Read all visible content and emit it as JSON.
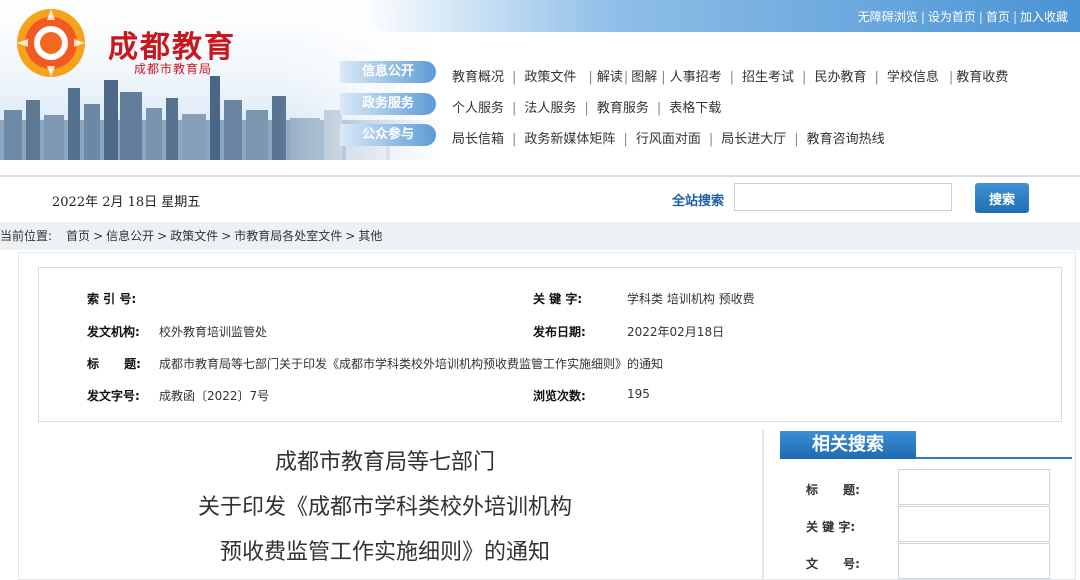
{
  "topbar": {
    "links": [
      "无障碍浏览",
      "设为首页",
      "首页",
      "加入收藏"
    ]
  },
  "logo": {
    "title": "成都教育",
    "subtitle": "成都市教育局"
  },
  "nav": {
    "rows": [
      {
        "category": "信息公开",
        "items": [
          "教育概况",
          "政策文件",
          "解读",
          "图解",
          "人事招考",
          "招生考试",
          "民办教育",
          "学校信息",
          "教育收费"
        ]
      },
      {
        "category": "政务服务",
        "items": [
          "个人服务",
          "法人服务",
          "教育服务",
          "表格下载"
        ]
      },
      {
        "category": "公众参与",
        "items": [
          "局长信箱",
          "政务新媒体矩阵",
          "行风面对面",
          "局长进大厅",
          "教育咨询热线"
        ]
      }
    ]
  },
  "datebar": {
    "date": "2022年 2月 18日 星期五",
    "search_label": "全站搜索",
    "search_value": "",
    "search_button": "搜索"
  },
  "breadcrumb": {
    "lead": "当前位置:",
    "items": [
      "首页",
      "信息公开",
      "政策文件",
      "市教育局各处室文件",
      "其他"
    ]
  },
  "meta": {
    "index_label": "索 引 号:",
    "index_value": "",
    "keyword_label": "关 键 字:",
    "keyword_value": "学科类 培训机构 预收费",
    "issuer_label": "发文机构:",
    "issuer_value": "校外教育培训监管处",
    "date_label": "发布日期:",
    "date_value": "2022年02月18日",
    "title_label": "标      题:",
    "title_value": "成都市教育局等七部门关于印发《成都市学科类校外培训机构预收费监管工作实施细则》的通知",
    "docno_label": "发文字号:",
    "docno_value": "成教函〔2022〕7号",
    "views_label": "浏览次数:",
    "views_value": "195"
  },
  "article": {
    "title_lines": [
      "成都市教育局等七部门",
      "关于印发《成都市学科类校外培训机构",
      "预收费监管工作实施细则》的通知"
    ]
  },
  "related": {
    "heading": "相关搜索",
    "fields": [
      "标      题:",
      "关 键 字:",
      "文      号:"
    ]
  },
  "colors": {
    "brand_red": "#c8171e",
    "brand_blue": "#1f6fb4",
    "topbar_blue": "#4a93d4"
  }
}
